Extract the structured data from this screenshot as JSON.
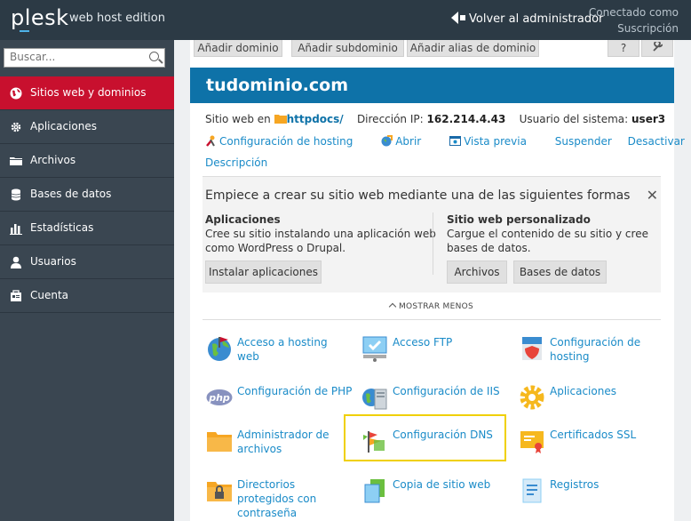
{
  "topbar": {
    "logo": "plesk",
    "edition": "web host edition",
    "back": "Volver al administrador",
    "login_line1": "Conectado como",
    "login_line2": "Suscripción"
  },
  "sidebar": {
    "search_placeholder": "Buscar...",
    "items": [
      {
        "label": "Sitios web y dominios",
        "icon": "globe-icon",
        "active": true
      },
      {
        "label": "Aplicaciones",
        "icon": "gear-icon"
      },
      {
        "label": "Archivos",
        "icon": "folder-icon"
      },
      {
        "label": "Bases de datos",
        "icon": "database-icon"
      },
      {
        "label": "Estadísticas",
        "icon": "bar-chart-icon"
      },
      {
        "label": "Usuarios",
        "icon": "user-icon"
      },
      {
        "label": "Cuenta",
        "icon": "account-icon"
      }
    ]
  },
  "toolbar": {
    "add_domain": "Añadir dominio",
    "add_subdomain": "Añadir subdominio",
    "add_alias": "Añadir alias de dominio",
    "help": "?"
  },
  "site": {
    "domain": "tudominio.com",
    "website_label": "Sitio web en",
    "docroot": "httpdocs/",
    "ip_label": "Dirección IP:",
    "ip": "162.214.4.43",
    "user_label": "Usuario del sistema:",
    "user": "user3",
    "actions": {
      "hosting": "Configuración de hosting",
      "open": "Abrir",
      "preview": "Vista previa",
      "suspend": "Suspender",
      "deactivate": "Desactivar"
    },
    "description": "Descripción"
  },
  "start": {
    "title": "Empiece a crear su sitio web mediante una de las siguientes formas",
    "apps_heading": "Aplicaciones",
    "apps_text_1": "Cree su sitio instalando una aplicación web",
    "apps_text_2": "como WordPress o Drupal.",
    "apps_button": "Instalar aplicaciones",
    "custom_heading": "Sitio web personalizado",
    "custom_text_1": "Cargue el contenido de su sitio y cree",
    "custom_text_2": "bases de datos.",
    "files_button": "Archivos",
    "db_button": "Bases de datos"
  },
  "show_less": "MOSTRAR MENOS",
  "tools": {
    "web_access": "Acceso a hosting web",
    "ftp": "Acceso FTP",
    "hosting_cfg_1": "Configuración de",
    "hosting_cfg_2": "hosting",
    "php": "Configuración de PHP",
    "iis": "Configuración de IIS",
    "apps": "Aplicaciones",
    "file_mgr_1": "Administrador de",
    "file_mgr_2": "archivos",
    "dns": "Configuración DNS",
    "ssl": "Certificados SSL",
    "protected_1": "Directorios",
    "protected_2": "protegidos con",
    "protected_3": "contraseña",
    "copy": "Copia de sitio web",
    "logs": "Registros"
  },
  "colors": {
    "topbar": "#2c3a45",
    "sidebar": "#3a4651",
    "active": "#c8102e",
    "header": "#0e72a8",
    "link": "#1a8bc8",
    "highlight": "#f0d000"
  }
}
